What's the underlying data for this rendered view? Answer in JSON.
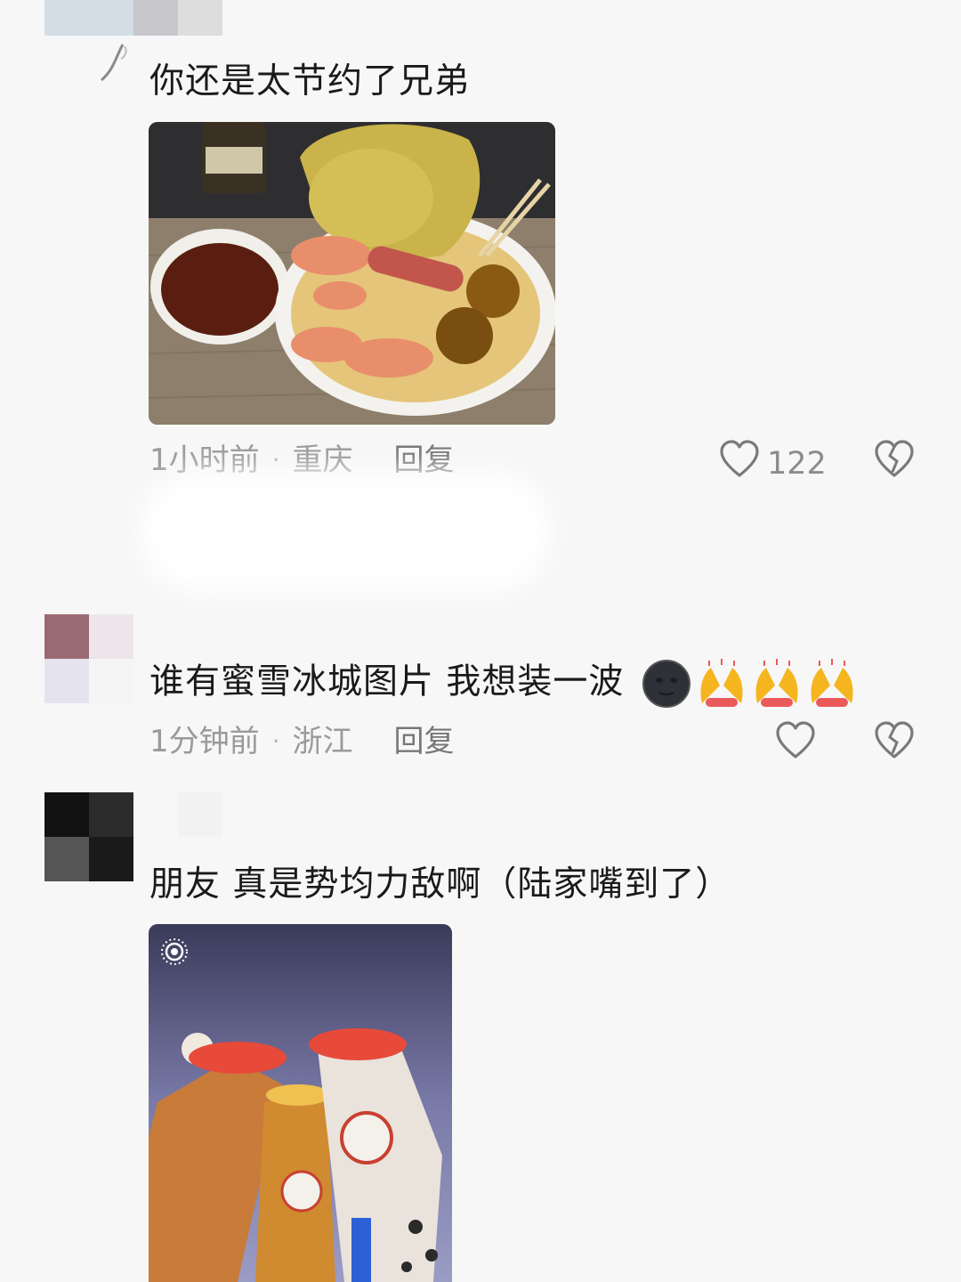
{
  "comments": [
    {
      "text": "你还是太节约了兄弟",
      "time": "1小时前",
      "separator": "·",
      "location": "重庆",
      "reply_label": "回复",
      "like_count": "122"
    },
    {
      "text": "谁有蜜雪冰城图片 我想装一波",
      "emoji": [
        "new-moon-face",
        "raising-hands",
        "raising-hands",
        "raising-hands"
      ],
      "time": "1分钟前",
      "separator": "·",
      "location": "浙江",
      "reply_label": "回复"
    },
    {
      "text": "朋友 真是势均力敌啊（陆家嘴到了）"
    }
  ],
  "colors": {
    "background": "#f7f7f7",
    "meta_text": "#9a9a9a",
    "icon_stroke": "#777777"
  }
}
